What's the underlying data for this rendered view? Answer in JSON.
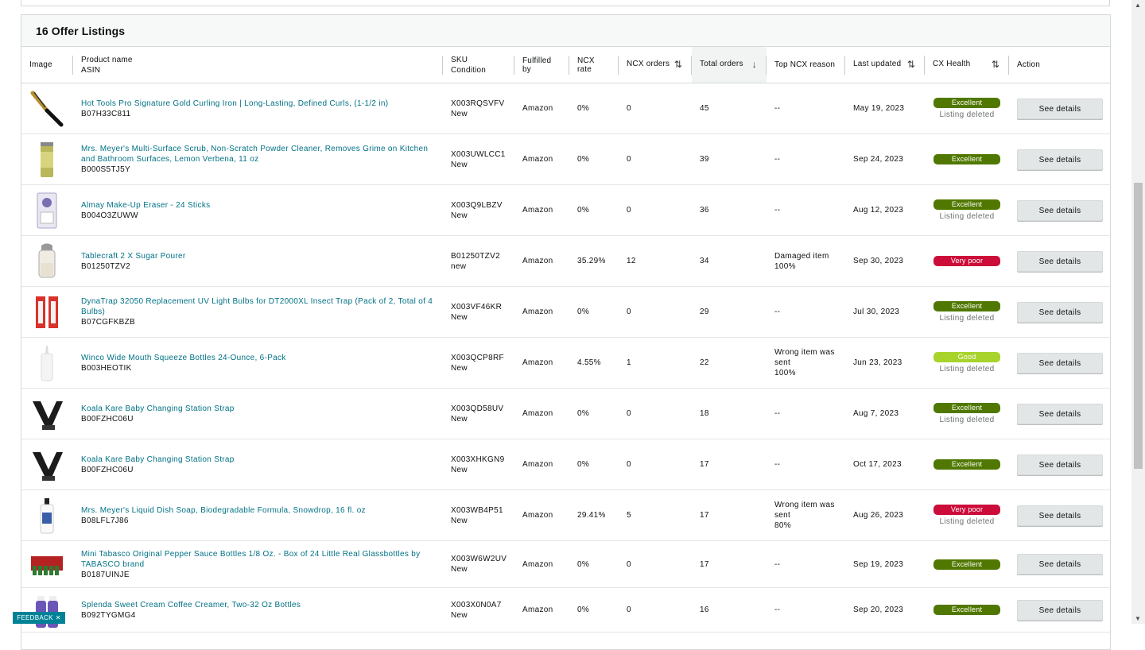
{
  "title": "16 Offer Listings",
  "columns": {
    "image": "Image",
    "product_name": "Product name",
    "asin": "ASIN",
    "sku": "SKU",
    "condition": "Condition",
    "fulfilled_by": "Fulfilled by",
    "ncx_rate": "NCX rate",
    "ncx_orders": "NCX orders",
    "total_orders": "Total orders",
    "top_ncx_reason": "Top NCX reason",
    "last_updated": "Last updated",
    "cx_health": "CX Health",
    "action": "Action"
  },
  "sort_icons": {
    "ncx_orders": "⇅",
    "total_orders": "↓",
    "last_updated": "⇅",
    "cx_health": "⇅"
  },
  "colors": {
    "Excellent": "#507800",
    "Good": "#a8d32b",
    "Very poor": "#cc0c39",
    "link": "#007185"
  },
  "rows": [
    {
      "image": "curling-iron-image",
      "name": "Hot Tools Pro Signature Gold Curling Iron | Long-Lasting, Defined Curls, (1-1/2 in)",
      "asin": "B07H33C811",
      "sku": "X003RQSVFV",
      "condition": "New",
      "fulfilled": "Amazon",
      "ncx_rate": "0%",
      "ncx_orders": "0",
      "total_orders": "45",
      "reason": [
        "--"
      ],
      "last_updated": "May 19, 2023",
      "health": "Excellent",
      "deleted": "Listing deleted",
      "action": "See details",
      "height": 64
    },
    {
      "image": "cleaner-can-image",
      "name": "Mrs. Meyer's Multi-Surface Scrub, Non-Scratch Powder Cleaner, Removes Grime on Kitchen and Bathroom Surfaces, Lemon Verbena, 11 oz",
      "asin": "B000S5TJ5Y",
      "sku": "X003UWLCC1",
      "condition": "New",
      "fulfilled": "Amazon",
      "ncx_rate": "0%",
      "ncx_orders": "0",
      "total_orders": "39",
      "reason": [
        "--"
      ],
      "last_updated": "Sep 24, 2023",
      "health": "Excellent",
      "deleted": "",
      "action": "See details",
      "height": 64
    },
    {
      "image": "makeup-eraser-image",
      "name": "Almay Make-Up Eraser - 24 Sticks",
      "asin": "B004O3ZUWW",
      "sku": "X003Q9LBZV",
      "condition": "New",
      "fulfilled": "Amazon",
      "ncx_rate": "0%",
      "ncx_orders": "0",
      "total_orders": "36",
      "reason": [
        "--"
      ],
      "last_updated": "Aug 12, 2023",
      "health": "Excellent",
      "deleted": "Listing deleted",
      "action": "See details",
      "height": 64
    },
    {
      "image": "sugar-pourer-image",
      "name": "Tablecraft 2 X Sugar Pourer",
      "asin": "B01250TZV2",
      "sku": "B01250TZV2",
      "condition": "new",
      "fulfilled": "Amazon",
      "ncx_rate": "35.29%",
      "ncx_orders": "12",
      "total_orders": "34",
      "reason": [
        "Damaged item",
        "100%"
      ],
      "last_updated": "Sep 30, 2023",
      "health": "Very poor",
      "deleted": "",
      "action": "See details",
      "height": 64
    },
    {
      "image": "uv-bulbs-image",
      "name": "DynaTrap 32050 Replacement UV Light Bulbs for DT2000XL Insect Trap (Pack of 2, Total of 4 Bulbs)",
      "asin": "B07CGFKBZB",
      "sku": "X003VF46KR",
      "condition": "New",
      "fulfilled": "Amazon",
      "ncx_rate": "0%",
      "ncx_orders": "0",
      "total_orders": "29",
      "reason": [
        "--"
      ],
      "last_updated": "Jul 30, 2023",
      "health": "Excellent",
      "deleted": "Listing deleted",
      "action": "See details",
      "height": 64
    },
    {
      "image": "squeeze-bottle-image",
      "name": "Winco Wide Mouth Squeeze Bottles 24-Ounce, 6-Pack",
      "asin": "B003HEOTIK",
      "sku": "X003QCP8RF",
      "condition": "New",
      "fulfilled": "Amazon",
      "ncx_rate": "4.55%",
      "ncx_orders": "1",
      "total_orders": "22",
      "reason": [
        "Wrong item was",
        "sent",
        "100%"
      ],
      "last_updated": "Jun 23, 2023",
      "health": "Good",
      "deleted": "Listing deleted",
      "action": "See details",
      "height": 64
    },
    {
      "image": "strap-image",
      "name": "Koala Kare Baby Changing Station Strap",
      "asin": "B00FZHC06U",
      "sku": "X003QD58UV",
      "condition": "New",
      "fulfilled": "Amazon",
      "ncx_rate": "0%",
      "ncx_orders": "0",
      "total_orders": "18",
      "reason": [
        "--"
      ],
      "last_updated": "Aug 7, 2023",
      "health": "Excellent",
      "deleted": "Listing deleted",
      "action": "See details",
      "height": 64
    },
    {
      "image": "strap-image",
      "name": "Koala Kare Baby Changing Station Strap",
      "asin": "B00FZHC06U",
      "sku": "X003XHKGN9",
      "condition": "New",
      "fulfilled": "Amazon",
      "ncx_rate": "0%",
      "ncx_orders": "0",
      "total_orders": "17",
      "reason": [
        "--"
      ],
      "last_updated": "Oct 17, 2023",
      "health": "Excellent",
      "deleted": "",
      "action": "See details",
      "height": 64
    },
    {
      "image": "dish-soap-image",
      "name": "Mrs. Meyer's Liquid Dish Soap, Biodegradable Formula, Snowdrop, 16 fl. oz",
      "asin": "B08LFL7J86",
      "sku": "X003WB4P51",
      "condition": "New",
      "fulfilled": "Amazon",
      "ncx_rate": "29.41%",
      "ncx_orders": "5",
      "total_orders": "17",
      "reason": [
        "Wrong item was",
        "sent",
        "80%"
      ],
      "last_updated": "Aug 26, 2023",
      "health": "Very poor",
      "deleted": "Listing deleted",
      "action": "See details",
      "height": 64
    },
    {
      "image": "tabasco-image",
      "name": "Mini Tabasco Original Pepper Sauce Bottles 1/8 Oz. - Box of 24 Little Real Glassbottles by TABASCO brand",
      "asin": "B0187UINJE",
      "sku": "X003W6W2UV",
      "condition": "New",
      "fulfilled": "Amazon",
      "ncx_rate": "0%",
      "ncx_orders": "0",
      "total_orders": "17",
      "reason": [
        "--"
      ],
      "last_updated": "Sep 19, 2023",
      "health": "Excellent",
      "deleted": "",
      "action": "See details",
      "height": 59
    },
    {
      "image": "creamer-image",
      "name": "Splenda Sweet Cream Coffee Creamer, Two-32 Oz Bottles",
      "asin": "B092TYGMG4",
      "sku": "X003X0N0A7",
      "condition": "New",
      "fulfilled": "Amazon",
      "ncx_rate": "0%",
      "ncx_orders": "0",
      "total_orders": "16",
      "reason": [
        "--"
      ],
      "last_updated": "Sep 20, 2023",
      "health": "Excellent",
      "deleted": "",
      "action": "See details",
      "height": 56
    }
  ],
  "feedback": {
    "label": "FEEDBACK",
    "close": "✕"
  }
}
